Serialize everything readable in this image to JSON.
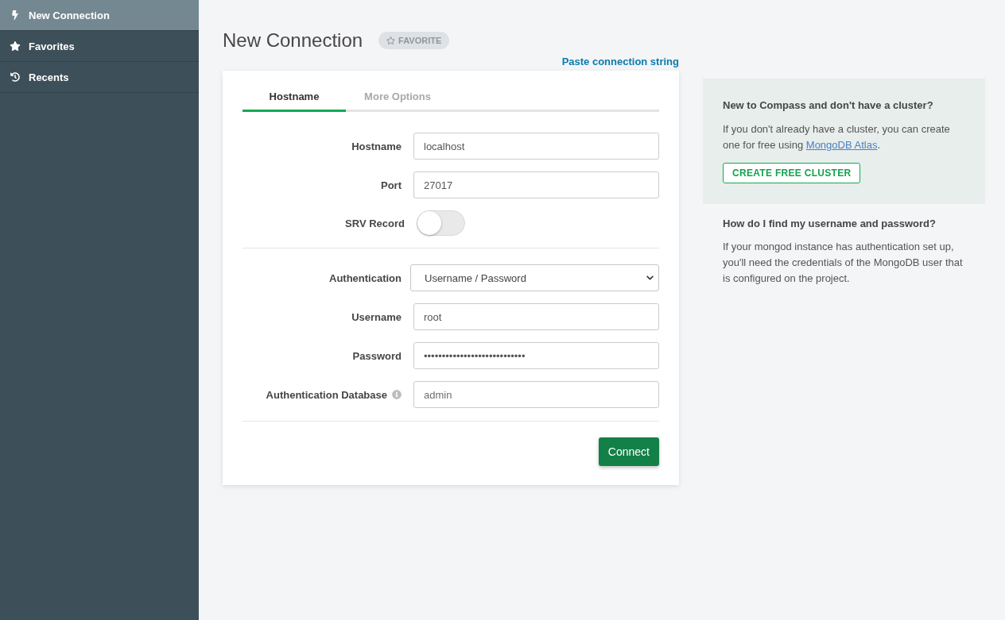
{
  "sidebar": {
    "items": [
      {
        "kind": "connection",
        "label": "New Connection",
        "selected": true
      },
      {
        "kind": "favorites",
        "label": "Favorites",
        "selected": false
      },
      {
        "kind": "recents",
        "label": "Recents",
        "selected": false
      }
    ]
  },
  "header": {
    "title": "New Connection",
    "favorite_button": "FAVORITE",
    "paste_link": "Paste connection string"
  },
  "form": {
    "tabs": [
      {
        "label": "Hostname",
        "selected": true
      },
      {
        "label": "More Options",
        "selected": false
      }
    ],
    "groups": [
      {
        "fields": [
          {
            "kind": "text",
            "label": "Hostname",
            "value": "localhost"
          },
          {
            "kind": "text",
            "label": "Port",
            "value": "27017"
          },
          {
            "kind": "toggle",
            "label": "SRV Record",
            "on": false
          }
        ]
      },
      {
        "fields": [
          {
            "kind": "select",
            "label": "Authentication",
            "value": "Username / Password"
          },
          {
            "kind": "text",
            "label": "Username",
            "value": "root"
          },
          {
            "kind": "text",
            "label": "Password",
            "value": "••••••••••••••••••••••••••••"
          },
          {
            "kind": "text",
            "label": "Authentication Database",
            "info": true,
            "placeholder": "admin"
          }
        ]
      }
    ],
    "connect_button": "Connect"
  },
  "help": [
    {
      "kind": "callout",
      "heading": "New to Compass and don't have a cluster?",
      "body": [
        {
          "kind": "text",
          "text": "If you don't already have a cluster, you can create one for free using "
        },
        {
          "kind": "link",
          "text": "MongoDB Atlas"
        },
        {
          "kind": "text",
          "text": "."
        }
      ],
      "button": "CREATE FREE CLUSTER"
    },
    {
      "kind": "plain",
      "heading": "How do I find my username and password?",
      "body": [
        {
          "kind": "text",
          "text": "If your mongod instance has authentication set up, you'll need the credentials of the MongoDB user that is configured on the project."
        }
      ]
    }
  ]
}
